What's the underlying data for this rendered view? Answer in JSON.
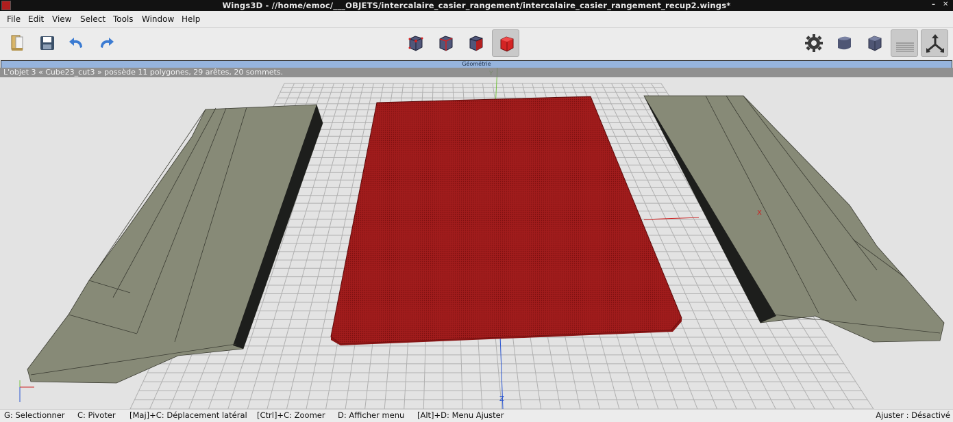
{
  "window": {
    "title": "Wings3D - //home/emoc/___OBJETS/intercalaire_casier_rangement/intercalaire_casier_rangement_recup2.wings*",
    "controls": {
      "minimize": "–",
      "close": "✕"
    }
  },
  "menu": [
    "File",
    "Edit",
    "View",
    "Select",
    "Tools",
    "Window",
    "Help"
  ],
  "toolbar": {
    "left": [
      {
        "name": "open-icon"
      },
      {
        "name": "save-icon"
      },
      {
        "name": "undo-icon"
      },
      {
        "name": "redo-icon"
      }
    ],
    "selection_modes": [
      {
        "name": "vertex-mode",
        "active": false
      },
      {
        "name": "edge-mode",
        "active": false
      },
      {
        "name": "face-mode",
        "active": false
      },
      {
        "name": "body-mode",
        "active": true
      }
    ],
    "right": [
      {
        "name": "gear-icon",
        "active": false
      },
      {
        "name": "smooth-cube",
        "active": false
      },
      {
        "name": "wire-cube",
        "active": false
      },
      {
        "name": "ground-grid",
        "active": true
      },
      {
        "name": "axes",
        "active": true
      }
    ]
  },
  "geometry_header": "Géométrie",
  "info_message": "L'objet 3 « Cube23_cut3 » possède 11 polygones, 29 arêtes, 20 sommets.",
  "viewport": {
    "axis_labels": {
      "x": "X",
      "y": "Y",
      "z": "Z"
    },
    "colors": {
      "grid": "#b0b0b0",
      "background": "#e3e3e3",
      "selected_face": "#a51e1e",
      "object_face": "#878a77",
      "object_side": "#1d1e1c",
      "x_axis": "#cc2020",
      "y_axis": "#74c040",
      "z_axis": "#2a55d0"
    }
  },
  "status": {
    "hints": [
      "G: Selectionner",
      "C: Pivoter",
      "[Maj]+C: Déplacement latéral",
      "[Ctrl]+C: Zoomer",
      "D: Afficher menu",
      "[Alt]+D: Menu Ajuster"
    ],
    "right": "Ajuster : Désactivé"
  }
}
